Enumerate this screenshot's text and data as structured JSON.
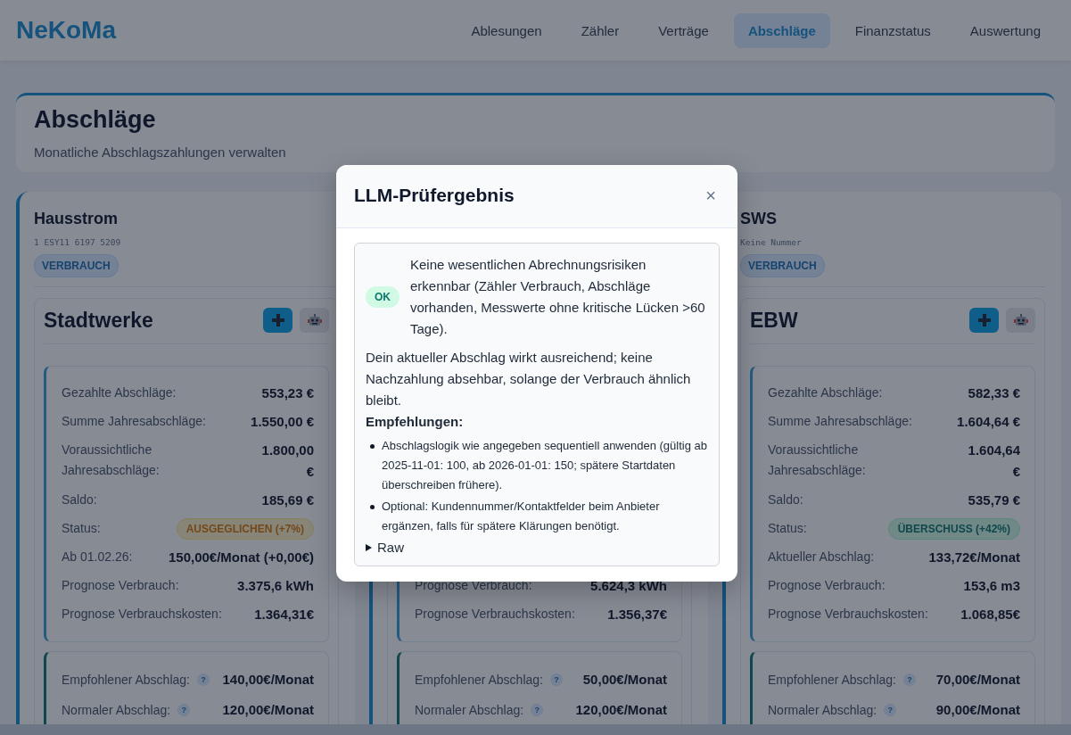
{
  "nav": {
    "brand": "NeKoMa",
    "items": [
      {
        "label": "Ablesungen",
        "selected": false
      },
      {
        "label": "Zähler",
        "selected": false
      },
      {
        "label": "Verträge",
        "selected": false
      },
      {
        "label": "Abschläge",
        "selected": true
      },
      {
        "label": "Finanzstatus",
        "selected": false
      },
      {
        "label": "Auswertung",
        "selected": false
      }
    ]
  },
  "page": {
    "title": "Abschläge",
    "subtitle": "Monatliche Abschlagszahlungen verwalten"
  },
  "columns": [
    {
      "title": "Hausstrom",
      "number": "1 ESY11 6197 5209",
      "tag": "VERBRAUCH",
      "provider": "Stadtwerke",
      "summary": [
        {
          "kind": "text",
          "label": "Gezahlte Abschläge:",
          "value": "553,23 €"
        },
        {
          "kind": "text",
          "label": "Summe Jahresabschläge:",
          "value": "1.550,00 €"
        },
        {
          "kind": "text",
          "label": "Voraussichtliche Jahresabschläge:",
          "value": "1.800,00 €"
        },
        {
          "kind": "text",
          "label": "Saldo:",
          "value": "185,69 €"
        },
        {
          "kind": "warning",
          "label": "Status:",
          "value": "AUSGEGLICHEN (+7%)"
        },
        {
          "kind": "text",
          "label": "Ab 01.02.26:",
          "value": "150,00€/Monat (+0,00€)"
        },
        {
          "kind": "text",
          "label": "Prognose Verbrauch:",
          "value": "3.375,6 kWh"
        },
        {
          "kind": "text",
          "label": "Prognose Verbrauchskosten:",
          "value": "1.364,31€"
        }
      ],
      "recommendations": [
        {
          "label": "Empfohlener Abschlag:",
          "help": "?",
          "value": "140,00€/Monat"
        },
        {
          "label": "Normaler Abschlag:",
          "help": "?",
          "value": "120,00€/Monat"
        }
      ]
    },
    {
      "summary": [
        {
          "kind": "text",
          "label": "Prognose Verbrauch:",
          "value": "5.624,3 kWh"
        },
        {
          "kind": "text",
          "label": "Prognose Verbrauchskosten:",
          "value": "1.356,37€"
        }
      ],
      "recommendations": [
        {
          "label": "Empfohlener Abschlag:",
          "help": "?",
          "value": "50,00€/Monat"
        },
        {
          "label": "Normaler Abschlag:",
          "help": "?",
          "value": "120,00€/Monat"
        }
      ]
    },
    {
      "title": "SWS",
      "number": "Keine Nummer",
      "tag": "VERBRAUCH",
      "provider": "EBW",
      "summary": [
        {
          "kind": "text",
          "label": "Gezahlte Abschläge:",
          "value": "582,33 €"
        },
        {
          "kind": "text",
          "label": "Summe Jahresabschläge:",
          "value": "1.604,64 €"
        },
        {
          "kind": "text",
          "label": "Voraussichtliche Jahresabschläge:",
          "value": "1.604,64 €"
        },
        {
          "kind": "text",
          "label": "Saldo:",
          "value": "535,79 €"
        },
        {
          "kind": "success",
          "label": "Status:",
          "value": "ÜBERSCHUSS (+42%)"
        },
        {
          "kind": "text",
          "label": "Aktueller Abschlag:",
          "value": "133,72€/Monat"
        },
        {
          "kind": "text",
          "label": "Prognose Verbrauch:",
          "value": "153,6 m3"
        },
        {
          "kind": "text",
          "label": "Prognose Verbrauchskosten:",
          "value": "1.068,85€"
        }
      ],
      "recommendations": [
        {
          "label": "Empfohlener Abschlag:",
          "help": "?",
          "value": "70,00€/Monat"
        },
        {
          "label": "Normaler Abschlag:",
          "help": "?",
          "value": "90,00€/Monat"
        }
      ]
    }
  ],
  "modal": {
    "title": "LLM-Prüfergebnis",
    "close": "×",
    "badge": "OK",
    "summary": "Keine wesentlichen Abrechnungsrisiken erkennbar (Zähler Verbrauch, Abschläge vorhanden, Messwerte ohne kritische Lücken >60 Tage).",
    "paragraph": "Dein aktueller Abschlag wirkt ausreichend; keine Nachzahlung absehbar, solange der Verbrauch ähnlich bleibt.",
    "heading": "Empfehlungen:",
    "items": [
      "Abschlagslogik wie angegeben sequentiell anwenden (gültig ab 2025-11-01: 100, ab 2026-01-01: 150; spätere Startdaten überschreiben frühere).",
      "Optional: Kundennummer/Kontaktfelder beim Anbieter ergänzen, falls für spätere Klärungen benötigt."
    ],
    "raw": "Raw"
  }
}
